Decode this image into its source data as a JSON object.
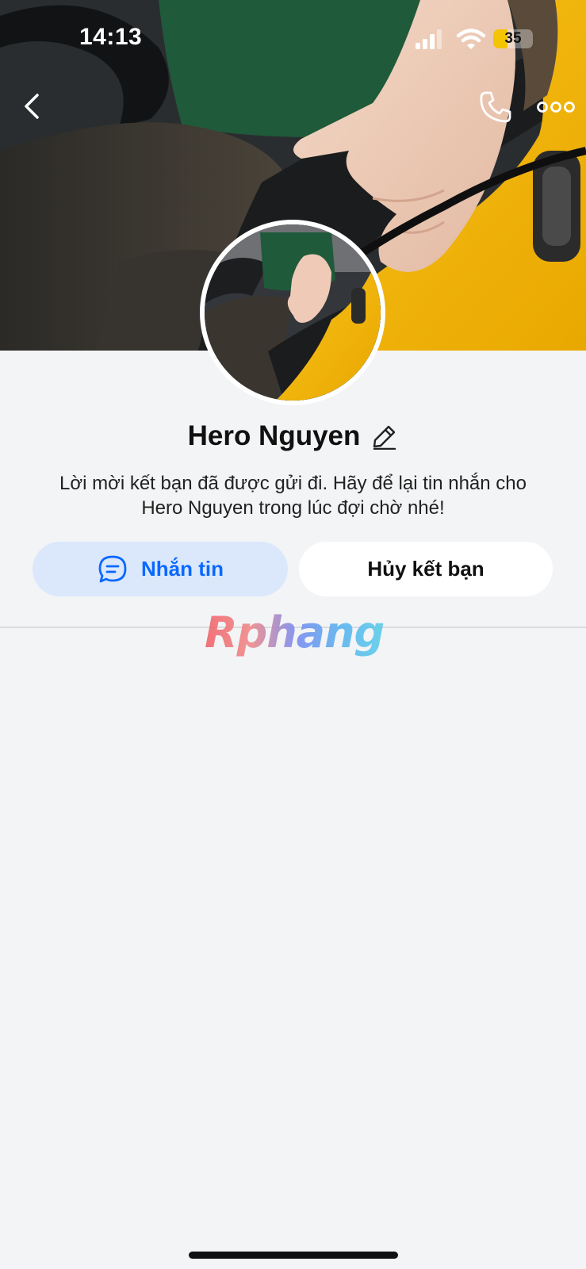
{
  "status_bar": {
    "time": "14:13",
    "battery_level": "35",
    "battery_fraction": 0.35,
    "icons": [
      "cellular-signal-icon",
      "wifi-icon",
      "battery-icon"
    ]
  },
  "nav": {
    "back_icon": "chevron-left-icon",
    "call_icon": "phone-icon",
    "more_icon": "more-horizontal-icon"
  },
  "profile": {
    "name": "Hero Nguyen",
    "edit_icon": "pencil-icon",
    "info_line_1": "Lời mời kết bạn đã được gửi đi. Hãy để lại tin nhắn cho",
    "info_line_2": "Hero Nguyen trong lúc đợi chờ nhé!"
  },
  "actions": {
    "message_label": "Nhắn tin",
    "message_icon": "chat-bubble-icon",
    "unfriend_label": "Hủy kết bạn"
  },
  "watermark": {
    "text": "Rphang"
  },
  "colors": {
    "accent_blue": "#0a68ff",
    "message_button_bg": "#dbe8fc",
    "page_bg": "#f3f4f6",
    "car_yellow": "#f5b800",
    "shirt_green": "#1f5a3a"
  }
}
